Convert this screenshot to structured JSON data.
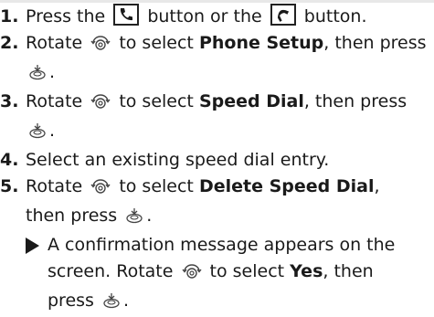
{
  "steps": [
    {
      "num": "1.",
      "a": "Press the",
      "b": "button or the",
      "c": "button."
    },
    {
      "num": "2.",
      "a": "Rotate",
      "b": "to select",
      "bold": "Phone Setup",
      "c": ", then press",
      "d": "."
    },
    {
      "num": "3.",
      "a": "Rotate",
      "b": "to select",
      "bold": "Speed Dial",
      "c": ", then press",
      "d": "."
    },
    {
      "num": "4.",
      "a": "Select an existing speed dial entry."
    },
    {
      "num": "5.",
      "a": "Rotate",
      "b": "to select",
      "bold": "Delete Speed Dial",
      "c": ",",
      "c2": "then press",
      "d": "."
    }
  ],
  "result": {
    "a": "A confirmation message appears on the",
    "b": "screen. Rotate",
    "c": "to select",
    "bold": "Yes",
    "d": ", then",
    "e": "press",
    "f": "."
  },
  "icons": {
    "pick_up": "phone-pickup-icon",
    "hang_up": "phone-hangup-icon",
    "selector_knob": "selector-knob-icon",
    "enter_button": "enter-button-icon"
  },
  "colors": {
    "text": "#1a1a1a",
    "strip": "#e8e8e8"
  }
}
